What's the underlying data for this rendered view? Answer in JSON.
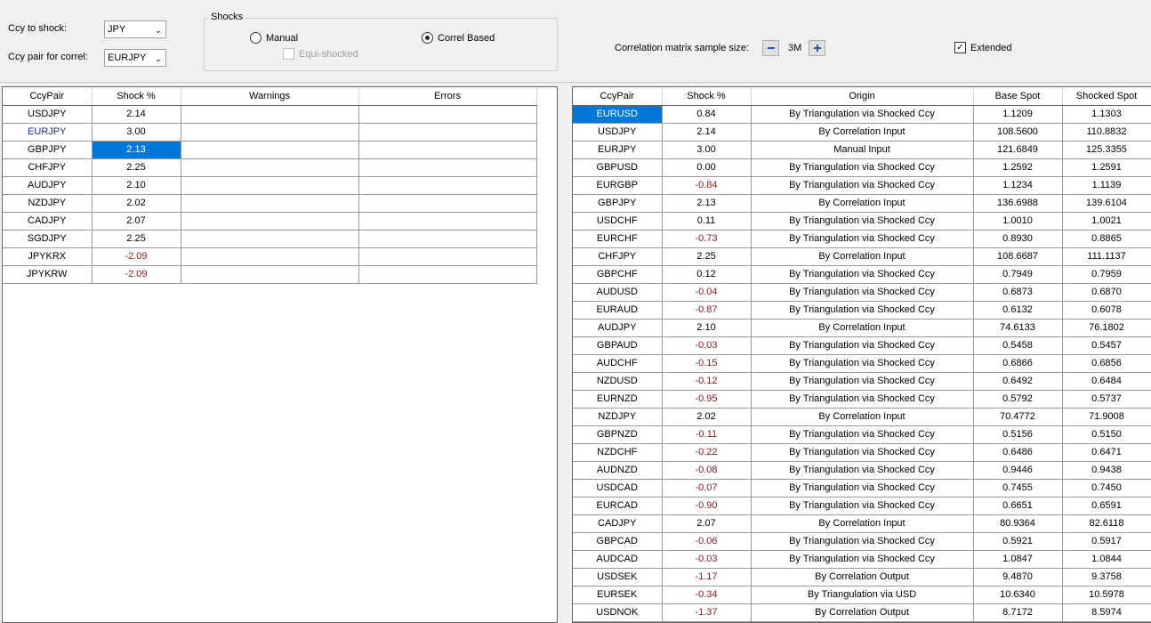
{
  "controls": {
    "ccy_to_shock_label": "Ccy to shock:",
    "ccy_to_shock_value": "JPY",
    "ccy_pair_label": "Ccy pair for correl:",
    "ccy_pair_value": "EURJPY",
    "shocks_group_title": "Shocks",
    "manual_label": "Manual",
    "correl_based_label": "Correl Based",
    "equi_shocked_label": "Equi-shocked",
    "sample_size_label": "Correlation matrix sample size:",
    "sample_size_value": "3M",
    "extended_label": "Extended",
    "extended_checked": true,
    "selected_shock_mode": "Correl Based"
  },
  "left_table": {
    "columns": [
      "CcyPair",
      "Shock %",
      "Warnings",
      "Errors"
    ],
    "rows": [
      {
        "pair": "USDJPY",
        "shock": "2.14",
        "warnings": "",
        "errors": ""
      },
      {
        "pair": "EURJPY",
        "shock": "3.00",
        "warnings": "",
        "errors": ""
      },
      {
        "pair": "GBPJPY",
        "shock": "2.13",
        "warnings": "",
        "errors": ""
      },
      {
        "pair": "CHFJPY",
        "shock": "2.25",
        "warnings": "",
        "errors": ""
      },
      {
        "pair": "AUDJPY",
        "shock": "2.10",
        "warnings": "",
        "errors": ""
      },
      {
        "pair": "NZDJPY",
        "shock": "2.02",
        "warnings": "",
        "errors": ""
      },
      {
        "pair": "CADJPY",
        "shock": "2.07",
        "warnings": "",
        "errors": ""
      },
      {
        "pair": "SGDJPY",
        "shock": "2.25",
        "warnings": "",
        "errors": ""
      },
      {
        "pair": "JPYKRX",
        "shock": "-2.09",
        "warnings": "",
        "errors": ""
      },
      {
        "pair": "JPYKRW",
        "shock": "-2.09",
        "warnings": "",
        "errors": ""
      }
    ]
  },
  "right_table": {
    "columns": [
      "CcyPair",
      "Shock %",
      "Origin",
      "Base Spot",
      "Shocked Spot"
    ],
    "rows": [
      {
        "pair": "EURUSD",
        "shock": "0.84",
        "origin": "By Triangulation via Shocked Ccy",
        "base": "1.1209",
        "shocked": "1.1303"
      },
      {
        "pair": "USDJPY",
        "shock": "2.14",
        "origin": "By Correlation Input",
        "base": "108.5600",
        "shocked": "110.8832"
      },
      {
        "pair": "EURJPY",
        "shock": "3.00",
        "origin": "Manual Input",
        "base": "121.6849",
        "shocked": "125.3355"
      },
      {
        "pair": "GBPUSD",
        "shock": "0.00",
        "origin": "By Triangulation via Shocked Ccy",
        "base": "1.2592",
        "shocked": "1.2591"
      },
      {
        "pair": "EURGBP",
        "shock": "-0.84",
        "origin": "By Triangulation via Shocked Ccy",
        "base": "1.1234",
        "shocked": "1.1139"
      },
      {
        "pair": "GBPJPY",
        "shock": "2.13",
        "origin": "By Correlation Input",
        "base": "136.6988",
        "shocked": "139.6104"
      },
      {
        "pair": "USDCHF",
        "shock": "0.11",
        "origin": "By Triangulation via Shocked Ccy",
        "base": "1.0010",
        "shocked": "1.0021"
      },
      {
        "pair": "EURCHF",
        "shock": "-0.73",
        "origin": "By Triangulation via Shocked Ccy",
        "base": "0.8930",
        "shocked": "0.8865"
      },
      {
        "pair": "CHFJPY",
        "shock": "2.25",
        "origin": "By Correlation Input",
        "base": "108.6687",
        "shocked": "111.1137"
      },
      {
        "pair": "GBPCHF",
        "shock": "0.12",
        "origin": "By Triangulation via Shocked Ccy",
        "base": "0.7949",
        "shocked": "0.7959"
      },
      {
        "pair": "AUDUSD",
        "shock": "-0.04",
        "origin": "By Triangulation via Shocked Ccy",
        "base": "0.6873",
        "shocked": "0.6870"
      },
      {
        "pair": "EURAUD",
        "shock": "-0.87",
        "origin": "By Triangulation via Shocked Ccy",
        "base": "0.6132",
        "shocked": "0.6078"
      },
      {
        "pair": "AUDJPY",
        "shock": "2.10",
        "origin": "By Correlation Input",
        "base": "74.6133",
        "shocked": "76.1802"
      },
      {
        "pair": "GBPAUD",
        "shock": "-0.03",
        "origin": "By Triangulation via Shocked Ccy",
        "base": "0.5458",
        "shocked": "0.5457"
      },
      {
        "pair": "AUDCHF",
        "shock": "-0.15",
        "origin": "By Triangulation via Shocked Ccy",
        "base": "0.6866",
        "shocked": "0.6856"
      },
      {
        "pair": "NZDUSD",
        "shock": "-0.12",
        "origin": "By Triangulation via Shocked Ccy",
        "base": "0.6492",
        "shocked": "0.6484"
      },
      {
        "pair": "EURNZD",
        "shock": "-0.95",
        "origin": "By Triangulation via Shocked Ccy",
        "base": "0.5792",
        "shocked": "0.5737"
      },
      {
        "pair": "NZDJPY",
        "shock": "2.02",
        "origin": "By Correlation Input",
        "base": "70.4772",
        "shocked": "71.9008"
      },
      {
        "pair": "GBPNZD",
        "shock": "-0.11",
        "origin": "By Triangulation via Shocked Ccy",
        "base": "0.5156",
        "shocked": "0.5150"
      },
      {
        "pair": "NZDCHF",
        "shock": "-0.22",
        "origin": "By Triangulation via Shocked Ccy",
        "base": "0.6486",
        "shocked": "0.6471"
      },
      {
        "pair": "AUDNZD",
        "shock": "-0.08",
        "origin": "By Triangulation via Shocked Ccy",
        "base": "0.9446",
        "shocked": "0.9438"
      },
      {
        "pair": "USDCAD",
        "shock": "-0.07",
        "origin": "By Triangulation via Shocked Ccy",
        "base": "0.7455",
        "shocked": "0.7450"
      },
      {
        "pair": "EURCAD",
        "shock": "-0.90",
        "origin": "By Triangulation via Shocked Ccy",
        "base": "0.6651",
        "shocked": "0.6591"
      },
      {
        "pair": "CADJPY",
        "shock": "2.07",
        "origin": "By Correlation Input",
        "base": "80.9364",
        "shocked": "82.6118"
      },
      {
        "pair": "GBPCAD",
        "shock": "-0.06",
        "origin": "By Triangulation via Shocked Ccy",
        "base": "0.5921",
        "shocked": "0.5917"
      },
      {
        "pair": "AUDCAD",
        "shock": "-0.03",
        "origin": "By Triangulation via Shocked Ccy",
        "base": "1.0847",
        "shocked": "1.0844"
      },
      {
        "pair": "USDSEK",
        "shock": "-1.17",
        "origin": "By Correlation Output",
        "base": "9.4870",
        "shocked": "9.3758"
      },
      {
        "pair": "EURSEK",
        "shock": "-0.34",
        "origin": "By Triangulation via USD",
        "base": "10.6340",
        "shocked": "10.5978"
      },
      {
        "pair": "USDNOK",
        "shock": "-1.37",
        "origin": "By Correlation Output",
        "base": "8.7172",
        "shocked": "8.5974"
      }
    ]
  },
  "colors": {
    "selection": "#0078d7",
    "negative": "#8b1a1a",
    "highlight_text": "#1c2a8c"
  }
}
